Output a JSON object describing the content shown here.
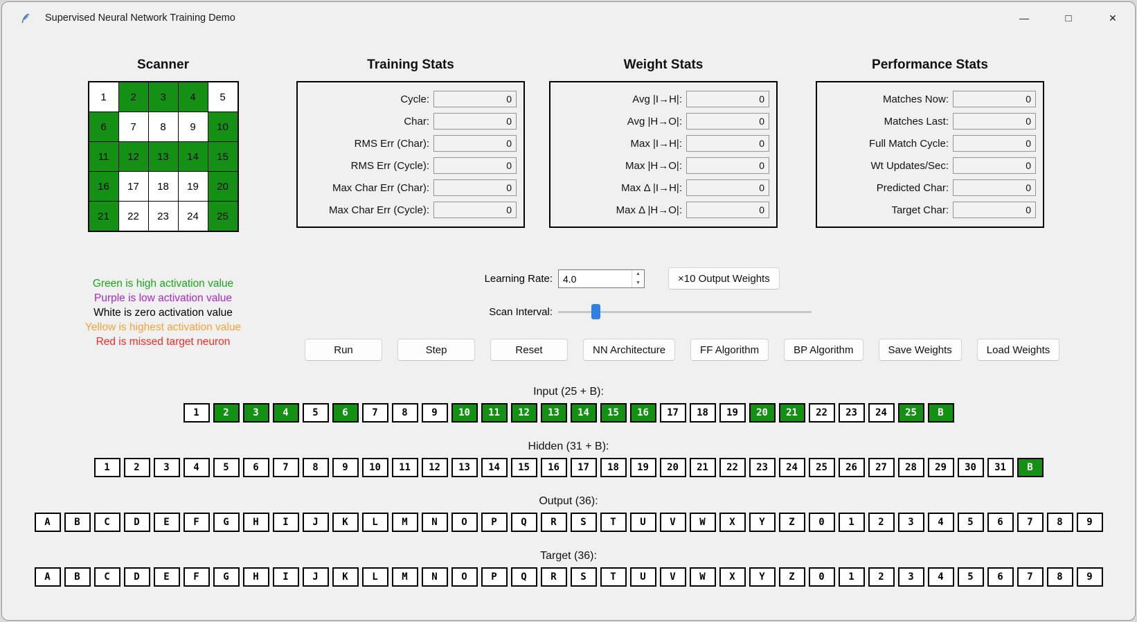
{
  "window": {
    "title": "Supervised Neural Network Training Demo",
    "minimize_glyph": "—",
    "maximize_glyph": "□",
    "close_glyph": "✕"
  },
  "colors": {
    "neuron_green": "#149114",
    "slider_thumb_blue": "#2f7fe3"
  },
  "scanner": {
    "title": "Scanner",
    "cells": [
      "1",
      "2",
      "3",
      "4",
      "5",
      "6",
      "7",
      "8",
      "9",
      "10",
      "11",
      "12",
      "13",
      "14",
      "15",
      "16",
      "17",
      "18",
      "19",
      "20",
      "21",
      "22",
      "23",
      "24",
      "25"
    ],
    "active": [
      "2",
      "3",
      "4",
      "6",
      "10",
      "11",
      "12",
      "13",
      "14",
      "15",
      "16",
      "20",
      "21",
      "25"
    ]
  },
  "stats": {
    "training": {
      "title": "Training Stats",
      "rows": [
        {
          "label": "Cycle:",
          "value": "0"
        },
        {
          "label": "Char:",
          "value": "0"
        },
        {
          "label": "RMS Err (Char):",
          "value": "0"
        },
        {
          "label": "RMS Err (Cycle):",
          "value": "0"
        },
        {
          "label": "Max Char Err (Char):",
          "value": "0"
        },
        {
          "label": "Max Char Err (Cycle):",
          "value": "0"
        }
      ]
    },
    "weight": {
      "title": "Weight Stats",
      "rows": [
        {
          "label": "Avg |I→H|:",
          "value": "0"
        },
        {
          "label": "Avg |H→O|:",
          "value": "0"
        },
        {
          "label": "Max |I→H|:",
          "value": "0"
        },
        {
          "label": "Max |H→O|:",
          "value": "0"
        },
        {
          "label": "Max Δ |I→H|:",
          "value": "0"
        },
        {
          "label": "Max Δ |H→O|:",
          "value": "0"
        }
      ]
    },
    "performance": {
      "title": "Performance Stats",
      "rows": [
        {
          "label": "Matches Now:",
          "value": "0"
        },
        {
          "label": "Matches Last:",
          "value": "0"
        },
        {
          "label": "Full Match Cycle:",
          "value": "0"
        },
        {
          "label": "Wt Updates/Sec:",
          "value": "0"
        },
        {
          "label": "Predicted Char:",
          "value": "0"
        },
        {
          "label": "Target Char:",
          "value": "0"
        }
      ]
    }
  },
  "legend": [
    {
      "text": "Green is high activation value",
      "color": "#1ba51b"
    },
    {
      "text": "Purple is low activation value",
      "color": "#a928c9"
    },
    {
      "text": "White is zero activation value",
      "color": "#000000"
    },
    {
      "text": "Yellow is highest activation value",
      "color": "#f5a33b"
    },
    {
      "text": "Red is missed target neuron",
      "color": "#f52b2b"
    }
  ],
  "controls": {
    "learning_rate_label": "Learning Rate:",
    "learning_rate_value": "4.0",
    "spin_up_glyph": "▲",
    "spin_down_glyph": "▼",
    "x10_button_label": "×10 Output Weights",
    "scan_interval_label": "Scan Interval:",
    "buttons": [
      "Run",
      "Step",
      "Reset",
      "NN Architecture",
      "FF Algorithm",
      "BP Algorithm",
      "Save Weights",
      "Load Weights"
    ]
  },
  "layers": {
    "input": {
      "label": "Input (25 + B):",
      "cells": [
        "1",
        "2",
        "3",
        "4",
        "5",
        "6",
        "7",
        "8",
        "9",
        "10",
        "11",
        "12",
        "13",
        "14",
        "15",
        "16",
        "17",
        "18",
        "19",
        "20",
        "21",
        "22",
        "23",
        "24",
        "25",
        "B"
      ],
      "active": [
        "2",
        "3",
        "4",
        "6",
        "10",
        "11",
        "12",
        "13",
        "14",
        "15",
        "16",
        "20",
        "21",
        "25",
        "B"
      ]
    },
    "hidden": {
      "label": "Hidden (31 + B):",
      "cells": [
        "1",
        "2",
        "3",
        "4",
        "5",
        "6",
        "7",
        "8",
        "9",
        "10",
        "11",
        "12",
        "13",
        "14",
        "15",
        "16",
        "17",
        "18",
        "19",
        "20",
        "21",
        "22",
        "23",
        "24",
        "25",
        "26",
        "27",
        "28",
        "29",
        "30",
        "31",
        "B"
      ],
      "active": [
        "B"
      ]
    },
    "output": {
      "label": "Output (36):",
      "cells": [
        "A",
        "B",
        "C",
        "D",
        "E",
        "F",
        "G",
        "H",
        "I",
        "J",
        "K",
        "L",
        "M",
        "N",
        "O",
        "P",
        "Q",
        "R",
        "S",
        "T",
        "U",
        "V",
        "W",
        "X",
        "Y",
        "Z",
        "0",
        "1",
        "2",
        "3",
        "4",
        "5",
        "6",
        "7",
        "8",
        "9"
      ],
      "active": []
    },
    "target": {
      "label": "Target (36):",
      "cells": [
        "A",
        "B",
        "C",
        "D",
        "E",
        "F",
        "G",
        "H",
        "I",
        "J",
        "K",
        "L",
        "M",
        "N",
        "O",
        "P",
        "Q",
        "R",
        "S",
        "T",
        "U",
        "V",
        "W",
        "X",
        "Y",
        "Z",
        "0",
        "1",
        "2",
        "3",
        "4",
        "5",
        "6",
        "7",
        "8",
        "9"
      ],
      "active": []
    }
  }
}
